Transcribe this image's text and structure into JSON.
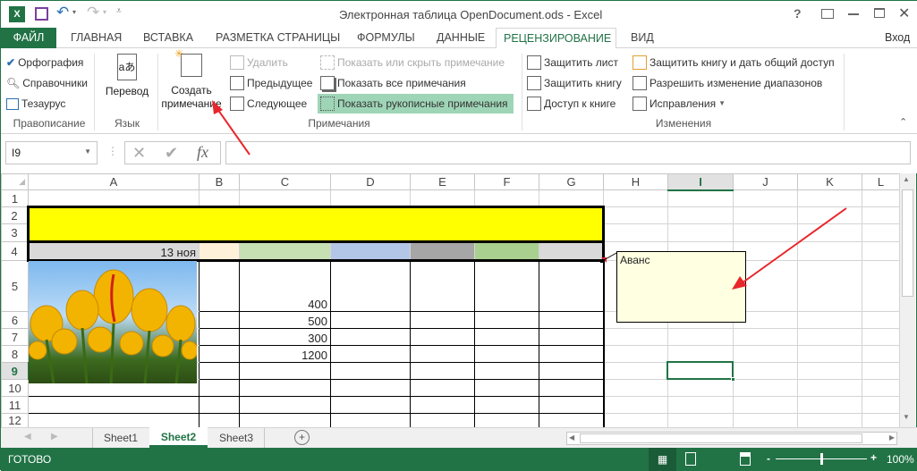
{
  "window": {
    "title": "Электронная таблица OpenDocument.ods - Excel",
    "help": "?",
    "signin": "Вход"
  },
  "tabs": [
    {
      "label": "ФАЙЛ"
    },
    {
      "label": "ГЛАВНАЯ"
    },
    {
      "label": "ВСТАВКА"
    },
    {
      "label": "РАЗМЕТКА СТРАНИЦЫ"
    },
    {
      "label": "ФОРМУЛЫ"
    },
    {
      "label": "ДАННЫЕ"
    },
    {
      "label": "РЕЦЕНЗИРОВАНИЕ",
      "active": true
    },
    {
      "label": "ВИД"
    }
  ],
  "ribbon": {
    "proofing": {
      "label": "Правописание",
      "spelling": "Орфография",
      "research": "Справочники",
      "thesaurus": "Тезаурус"
    },
    "language": {
      "label": "Язык",
      "translate": "Перевод"
    },
    "comments": {
      "label": "Примечания",
      "new_line1": "Создать",
      "new_line2": "примечание",
      "delete": "Удалить",
      "previous": "Предыдущее",
      "next": "Следующее",
      "show_hide": "Показать или скрыть примечание",
      "show_all": "Показать все примечания",
      "show_ink": "Показать рукописные примечания"
    },
    "changes": {
      "label": "Изменения",
      "protect_sheet": "Защитить лист",
      "protect_book": "Защитить книгу",
      "share_book": "Доступ к книге",
      "protect_share": "Защитить книгу и дать общий доступ",
      "allow_ranges": "Разрешить изменение диапазонов",
      "track": "Исправления"
    }
  },
  "formula_bar": {
    "name_box": "I9",
    "value": ""
  },
  "columns": [
    "A",
    "B",
    "C",
    "D",
    "E",
    "F",
    "G",
    "H",
    "I",
    "J",
    "K",
    "L"
  ],
  "rows": [
    "1",
    "2",
    "3",
    "4",
    "5",
    "6",
    "7",
    "8",
    "9",
    "10",
    "11",
    "12"
  ],
  "cells": {
    "A4": "13 ноя",
    "C5": "400",
    "C6": "500",
    "C7": "300",
    "C8": "1200"
  },
  "row4_colors": [
    "#d9d9d9",
    "#fdf2d9",
    "#c6e0b4",
    "#b4c6e7",
    "#a6a6a6",
    "#a9d08e",
    "#d9d9d9"
  ],
  "comment": {
    "text": "Аванс",
    "bg": "#ffffe1"
  },
  "sheets": [
    {
      "label": "Sheet1"
    },
    {
      "label": "Sheet2",
      "active": true
    },
    {
      "label": "Sheet3"
    }
  ],
  "status": {
    "text": "ГОТОВО",
    "zoom": "100%"
  },
  "colors": {
    "accent": "#217346",
    "header_fill": "#ffff00",
    "annotation_arrow": "#e8262b"
  }
}
